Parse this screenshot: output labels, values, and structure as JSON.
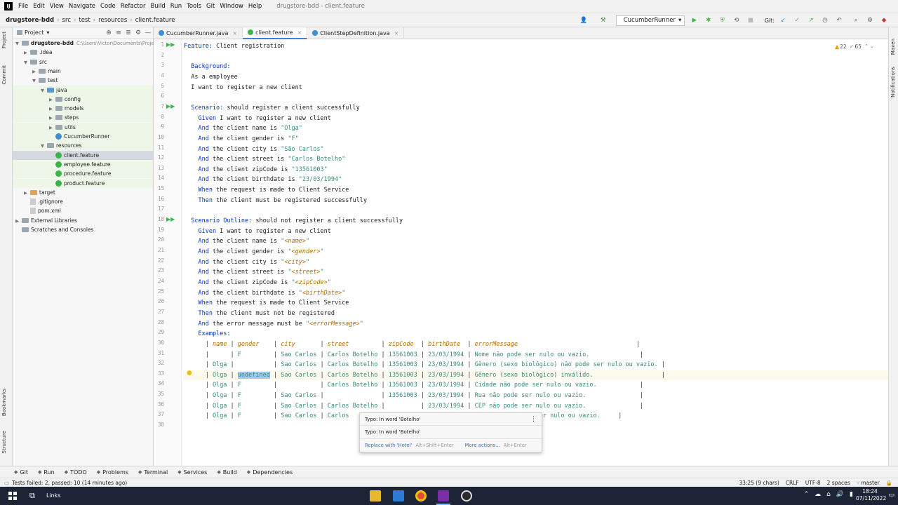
{
  "menu": {
    "app_icon": "intellij-logo-icon",
    "items": [
      "File",
      "Edit",
      "View",
      "Navigate",
      "Code",
      "Refactor",
      "Build",
      "Run",
      "Tools",
      "Git",
      "Window",
      "Help"
    ],
    "window_title": "drugstore-bdd - client.feature"
  },
  "breadcrumb": [
    "drugstore-bdd",
    "src",
    "test",
    "resources",
    "client.feature"
  ],
  "toolbar": {
    "run_config": "CucumberRunner",
    "git_label": "Git:"
  },
  "side_labels": {
    "project": "Project",
    "commit": "Commit",
    "bookmarks": "Bookmarks",
    "structure": "Structure",
    "maven": "Maven",
    "notifications": "Notifications"
  },
  "project": {
    "title": "Project",
    "tree": [
      {
        "label": "drugstore-bdd",
        "extra": "C:\\Users\\Victor\\Documents\\Proje",
        "icon": "folder",
        "depth": 0,
        "arrow": "down",
        "bold": true
      },
      {
        "label": ".idea",
        "icon": "folder",
        "depth": 1,
        "arrow": "right"
      },
      {
        "label": "src",
        "icon": "folder",
        "depth": 1,
        "arrow": "down"
      },
      {
        "label": "main",
        "icon": "folder",
        "depth": 2,
        "arrow": "right"
      },
      {
        "label": "test",
        "icon": "folder",
        "depth": 2,
        "arrow": "down"
      },
      {
        "label": "java",
        "icon": "folder-teal",
        "depth": 3,
        "arrow": "down"
      },
      {
        "label": "config",
        "icon": "folder",
        "depth": 4,
        "arrow": "right"
      },
      {
        "label": "models",
        "icon": "folder",
        "depth": 4,
        "arrow": "right"
      },
      {
        "label": "steps",
        "icon": "folder",
        "depth": 4,
        "arrow": "right"
      },
      {
        "label": "utils",
        "icon": "folder",
        "depth": 4,
        "arrow": "right"
      },
      {
        "label": "CucumberRunner",
        "icon": "class",
        "depth": 4,
        "arrow": ""
      },
      {
        "label": "resources",
        "icon": "folder",
        "depth": 3,
        "arrow": "down"
      },
      {
        "label": "client.feature",
        "icon": "feature",
        "depth": 4,
        "arrow": "",
        "selected": true
      },
      {
        "label": "employee.feature",
        "icon": "feature",
        "depth": 4,
        "arrow": ""
      },
      {
        "label": "procedure.feature",
        "icon": "feature",
        "depth": 4,
        "arrow": ""
      },
      {
        "label": "product.feature",
        "icon": "feature",
        "depth": 4,
        "arrow": ""
      },
      {
        "label": "target",
        "icon": "folder-orange",
        "depth": 1,
        "arrow": "right"
      },
      {
        "label": ".gitignore",
        "icon": "file",
        "depth": 1,
        "arrow": ""
      },
      {
        "label": "pom.xml",
        "icon": "file",
        "depth": 1,
        "arrow": ""
      },
      {
        "label": "External Libraries",
        "icon": "library",
        "depth": 0,
        "arrow": "right"
      },
      {
        "label": "Scratches and Consoles",
        "icon": "scratch",
        "depth": 0,
        "arrow": ""
      }
    ]
  },
  "tabs": [
    {
      "label": "CucumberRunner.java",
      "icon": "class"
    },
    {
      "label": "client.feature",
      "icon": "feature",
      "active": true
    },
    {
      "label": "ClientStepDefinition.java",
      "icon": "class"
    }
  ],
  "inspections": {
    "warnings": "22",
    "weak": "65"
  },
  "code_lines": [
    [
      {
        "t": "Feature:",
        "c": "kw"
      },
      {
        "t": " Client registration",
        "c": ""
      }
    ],
    [],
    [
      {
        "t": "  Background:",
        "c": "kw"
      }
    ],
    [
      {
        "t": "  As a employee",
        "c": ""
      }
    ],
    [
      {
        "t": "  I want to register a new client",
        "c": ""
      }
    ],
    [],
    [
      {
        "t": "  Scenario:",
        "c": "kw"
      },
      {
        "t": " should register a client successfully",
        "c": ""
      }
    ],
    [
      {
        "t": "    Given",
        "c": "kw"
      },
      {
        "t": " I want to register a new client",
        "c": ""
      }
    ],
    [
      {
        "t": "    And",
        "c": "kw"
      },
      {
        "t": " the client name is ",
        "c": ""
      },
      {
        "t": "\"Olga\"",
        "c": "str"
      }
    ],
    [
      {
        "t": "    And",
        "c": "kw"
      },
      {
        "t": " the client gender is ",
        "c": ""
      },
      {
        "t": "\"F\"",
        "c": "str"
      }
    ],
    [
      {
        "t": "    And",
        "c": "kw"
      },
      {
        "t": " the client city is ",
        "c": ""
      },
      {
        "t": "\"São Carlos\"",
        "c": "str"
      }
    ],
    [
      {
        "t": "    And",
        "c": "kw"
      },
      {
        "t": " the client street is ",
        "c": ""
      },
      {
        "t": "\"Carlos Botelho\"",
        "c": "str"
      }
    ],
    [
      {
        "t": "    And",
        "c": "kw"
      },
      {
        "t": " the client zipCode is ",
        "c": ""
      },
      {
        "t": "\"13561003\"",
        "c": "str"
      }
    ],
    [
      {
        "t": "    And",
        "c": "kw"
      },
      {
        "t": " the client birthdate is ",
        "c": ""
      },
      {
        "t": "\"23/03/1994\"",
        "c": "str"
      }
    ],
    [
      {
        "t": "    When",
        "c": "kw"
      },
      {
        "t": " the request is made to Client Service",
        "c": ""
      }
    ],
    [
      {
        "t": "    Then",
        "c": "kw"
      },
      {
        "t": " the client must be registered successfully",
        "c": ""
      }
    ],
    [],
    [
      {
        "t": "  Scenario Outline:",
        "c": "kw"
      },
      {
        "t": " should not register a client successfully",
        "c": ""
      }
    ],
    [
      {
        "t": "    Given",
        "c": "kw"
      },
      {
        "t": " I want to register a new client",
        "c": ""
      }
    ],
    [
      {
        "t": "    And",
        "c": "kw"
      },
      {
        "t": " the client name is ",
        "c": ""
      },
      {
        "t": "\"",
        "c": "str"
      },
      {
        "t": "<name>",
        "c": "ph"
      },
      {
        "t": "\"",
        "c": "str"
      }
    ],
    [
      {
        "t": "    And",
        "c": "kw"
      },
      {
        "t": " the client gender is ",
        "c": ""
      },
      {
        "t": "\"",
        "c": "str"
      },
      {
        "t": "<gender>",
        "c": "ph"
      },
      {
        "t": "\"",
        "c": "str"
      }
    ],
    [
      {
        "t": "    And",
        "c": "kw"
      },
      {
        "t": " the client city is ",
        "c": ""
      },
      {
        "t": "\"",
        "c": "str"
      },
      {
        "t": "<city>",
        "c": "ph"
      },
      {
        "t": "\"",
        "c": "str"
      }
    ],
    [
      {
        "t": "    And",
        "c": "kw"
      },
      {
        "t": " the client street is ",
        "c": ""
      },
      {
        "t": "\"",
        "c": "str"
      },
      {
        "t": "<street>",
        "c": "ph"
      },
      {
        "t": "\"",
        "c": "str"
      }
    ],
    [
      {
        "t": "    And",
        "c": "kw"
      },
      {
        "t": " the client zipCode is ",
        "c": ""
      },
      {
        "t": "\"",
        "c": "str"
      },
      {
        "t": "<zipCode>",
        "c": "ph"
      },
      {
        "t": "\"",
        "c": "str"
      }
    ],
    [
      {
        "t": "    And",
        "c": "kw"
      },
      {
        "t": " the client birthdate is ",
        "c": ""
      },
      {
        "t": "\"",
        "c": "str"
      },
      {
        "t": "<birthDate>",
        "c": "ph"
      },
      {
        "t": "\"",
        "c": "str"
      }
    ],
    [
      {
        "t": "    When",
        "c": "kw"
      },
      {
        "t": " the request is made to Client Service",
        "c": ""
      }
    ],
    [
      {
        "t": "    Then",
        "c": "kw"
      },
      {
        "t": " the client must not be registered",
        "c": ""
      }
    ],
    [
      {
        "t": "    And",
        "c": "kw"
      },
      {
        "t": " the error message must be ",
        "c": ""
      },
      {
        "t": "\"",
        "c": "str"
      },
      {
        "t": "<errorMessage>",
        "c": "ph"
      },
      {
        "t": "\"",
        "c": "str"
      }
    ],
    [
      {
        "t": "    Examples:",
        "c": "kw"
      }
    ],
    [
      {
        "t": "      | ",
        "c": "pipe"
      },
      {
        "t": "name",
        "c": "hdr"
      },
      {
        "t": " | ",
        "c": "pipe"
      },
      {
        "t": "gender",
        "c": "hdr"
      },
      {
        "t": "    | ",
        "c": "pipe"
      },
      {
        "t": "city",
        "c": "hdr"
      },
      {
        "t": "       | ",
        "c": "pipe"
      },
      {
        "t": "street",
        "c": "hdr"
      },
      {
        "t": "         | ",
        "c": "pipe"
      },
      {
        "t": "zipCode",
        "c": "hdr"
      },
      {
        "t": "  | ",
        "c": "pipe"
      },
      {
        "t": "birthDate",
        "c": "hdr"
      },
      {
        "t": "  | ",
        "c": "pipe"
      },
      {
        "t": "errorMessage",
        "c": "hdr"
      },
      {
        "t": "                                 |",
        "c": "pipe"
      }
    ],
    [
      {
        "t": "      |      | ",
        "c": "pipe"
      },
      {
        "t": "F",
        "c": "str"
      },
      {
        "t": "         | ",
        "c": "pipe"
      },
      {
        "t": "Sao Carlos",
        "c": "str"
      },
      {
        "t": " | ",
        "c": "pipe"
      },
      {
        "t": "Carlos Botelho",
        "c": "str"
      },
      {
        "t": " | ",
        "c": "pipe"
      },
      {
        "t": "13561003",
        "c": "str"
      },
      {
        "t": " | ",
        "c": "pipe"
      },
      {
        "t": "23/03/1994",
        "c": "str"
      },
      {
        "t": " | ",
        "c": "pipe"
      },
      {
        "t": "Nome não pode ser nulo ou vazio.",
        "c": "str"
      },
      {
        "t": "              |",
        "c": "pipe"
      }
    ],
    [
      {
        "t": "      | ",
        "c": "pipe"
      },
      {
        "t": "Olga",
        "c": "str"
      },
      {
        "t": " |           | ",
        "c": "pipe"
      },
      {
        "t": "Sao Carlos",
        "c": "str"
      },
      {
        "t": " | ",
        "c": "pipe"
      },
      {
        "t": "Carlos Botelho",
        "c": "str"
      },
      {
        "t": " | ",
        "c": "pipe"
      },
      {
        "t": "13561003",
        "c": "str"
      },
      {
        "t": " | ",
        "c": "pipe"
      },
      {
        "t": "23/03/1994",
        "c": "str"
      },
      {
        "t": " | ",
        "c": "pipe"
      },
      {
        "t": "Gênero (sexo biológico) não pode ser nulo ou vazio.",
        "c": "str"
      },
      {
        "t": " |",
        "c": "pipe"
      }
    ],
    [
      {
        "t": "      | ",
        "c": "pipe"
      },
      {
        "t": "Olga",
        "c": "str"
      },
      {
        "t": " | ",
        "c": "pipe"
      },
      {
        "t": "undefined",
        "c": "sel"
      },
      {
        "t": " | ",
        "c": "pipe"
      },
      {
        "t": "Sao Carlos",
        "c": "str"
      },
      {
        "t": " | ",
        "c": "pipe"
      },
      {
        "t": "Carlos Botelho",
        "c": "str"
      },
      {
        "t": " | ",
        "c": "pipe"
      },
      {
        "t": "13561003",
        "c": "str"
      },
      {
        "t": " | ",
        "c": "pipe"
      },
      {
        "t": "23/03/1994",
        "c": "str"
      },
      {
        "t": " | ",
        "c": "pipe"
      },
      {
        "t": "Gênero (sexo biológico) inválido.",
        "c": "str"
      },
      {
        "t": "                   |",
        "c": "pipe"
      }
    ],
    [
      {
        "t": "      | ",
        "c": "pipe"
      },
      {
        "t": "Olga",
        "c": "str"
      },
      {
        "t": " | ",
        "c": "pipe"
      },
      {
        "t": "F",
        "c": "str"
      },
      {
        "t": "         |            | ",
        "c": "pipe"
      },
      {
        "t": "Carlos Botelho",
        "c": "str"
      },
      {
        "t": " | ",
        "c": "pipe"
      },
      {
        "t": "13561003",
        "c": "str"
      },
      {
        "t": " | ",
        "c": "pipe"
      },
      {
        "t": "23/03/1994",
        "c": "str"
      },
      {
        "t": " | ",
        "c": "pipe"
      },
      {
        "t": "Cidade não pode ser nulo ou vazio.",
        "c": "str"
      },
      {
        "t": "            |",
        "c": "pipe"
      }
    ],
    [
      {
        "t": "      | ",
        "c": "pipe"
      },
      {
        "t": "Olga",
        "c": "str"
      },
      {
        "t": " | ",
        "c": "pipe"
      },
      {
        "t": "F",
        "c": "str"
      },
      {
        "t": "         | ",
        "c": "pipe"
      },
      {
        "t": "Sao Carlos",
        "c": "str"
      },
      {
        "t": " |                | ",
        "c": "pipe"
      },
      {
        "t": "13561003",
        "c": "str"
      },
      {
        "t": " | ",
        "c": "pipe"
      },
      {
        "t": "23/03/1994",
        "c": "str"
      },
      {
        "t": " | ",
        "c": "pipe"
      },
      {
        "t": "Rua não pode ser nulo ou vazio.",
        "c": "str"
      },
      {
        "t": "               |",
        "c": "pipe"
      }
    ],
    [
      {
        "t": "      | ",
        "c": "pipe"
      },
      {
        "t": "Olga",
        "c": "str"
      },
      {
        "t": " | ",
        "c": "pipe"
      },
      {
        "t": "F",
        "c": "str"
      },
      {
        "t": "         | ",
        "c": "pipe"
      },
      {
        "t": "Sao Carlos",
        "c": "str"
      },
      {
        "t": " | ",
        "c": "pipe"
      },
      {
        "t": "Carlos Botelho",
        "c": "str"
      },
      {
        "t": " |          | ",
        "c": "pipe"
      },
      {
        "t": "23/03/1994",
        "c": "str"
      },
      {
        "t": " | ",
        "c": "pipe"
      },
      {
        "t": "CEP não pode ser nulo ou vazio.",
        "c": "str"
      },
      {
        "t": "               |",
        "c": "pipe"
      }
    ],
    [
      {
        "t": "      | ",
        "c": "pipe"
      },
      {
        "t": "Olga",
        "c": "str"
      },
      {
        "t": " | ",
        "c": "pipe"
      },
      {
        "t": "F",
        "c": "str"
      },
      {
        "t": "         | ",
        "c": "pipe"
      },
      {
        "t": "Sao Carlos",
        "c": "str"
      },
      {
        "t": " | ",
        "c": "pipe"
      },
      {
        "t": "Carlos",
        "c": "str"
      },
      {
        "t": "                                       ",
        "c": ""
      },
      {
        "t": "nto não pode ser nulo ou vazio.",
        "c": "str"
      },
      {
        "t": "     |",
        "c": "pipe"
      }
    ],
    []
  ],
  "run_gutter_lines": [
    1,
    7,
    18
  ],
  "popup": {
    "line1": "Typo: In word 'Botelho'",
    "line2": "Typo: In word 'Botelho'",
    "action1": "Replace with 'Hotel'",
    "shortcut1": "Alt+Shift+Enter",
    "action2": "More actions...",
    "shortcut2": "Alt+Enter"
  },
  "bottom_tools": [
    {
      "label": "Git",
      "icon": "git-icon"
    },
    {
      "label": "Run",
      "icon": "run-icon"
    },
    {
      "label": "TODO",
      "icon": "todo-icon"
    },
    {
      "label": "Problems",
      "icon": "problems-icon"
    },
    {
      "label": "Terminal",
      "icon": "terminal-icon"
    },
    {
      "label": "Services",
      "icon": "services-icon"
    },
    {
      "label": "Build",
      "icon": "build-icon"
    },
    {
      "label": "Dependencies",
      "icon": "dependencies-icon"
    }
  ],
  "status": {
    "message": "Tests failed: 2, passed: 10 (14 minutes ago)",
    "position": "33:25 (9 chars)",
    "line_sep": "CRLF",
    "encoding": "UTF-8",
    "indent": "2 spaces",
    "branch": "master"
  },
  "taskbar": {
    "search": "Links",
    "time": "18:24",
    "date": "07/11/2022"
  },
  "colors": {
    "accent": "#4083c9",
    "keyword": "#0033b3",
    "string": "#3a8a7c",
    "placeholder": "#b26b00",
    "run": "#3ab54a"
  }
}
